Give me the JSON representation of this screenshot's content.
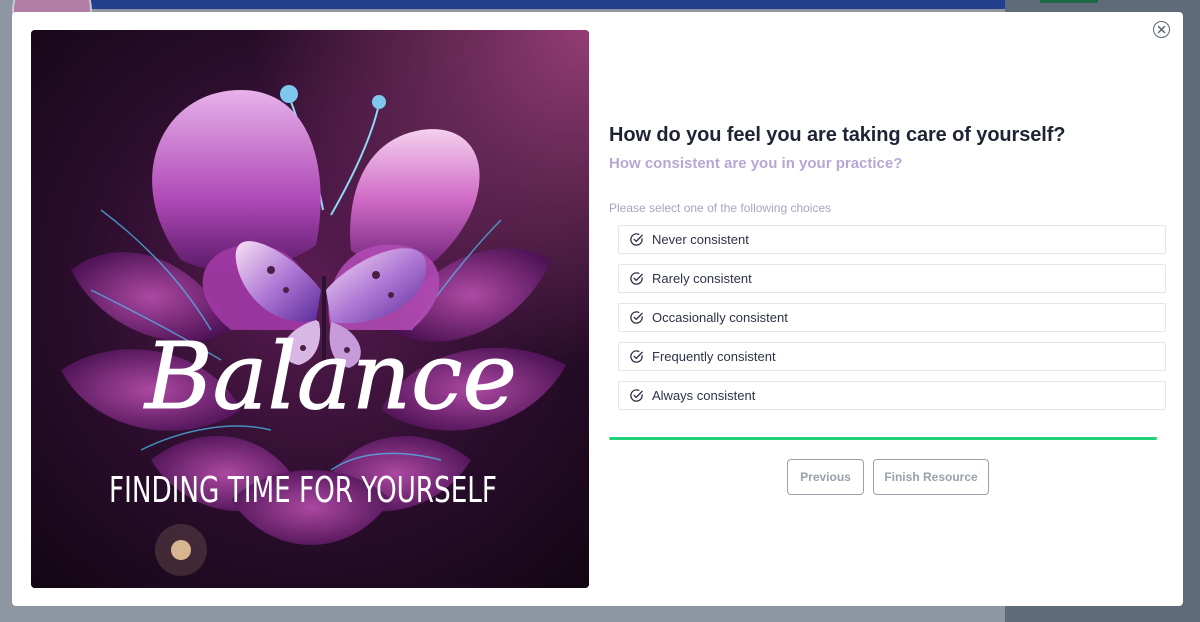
{
  "modal": {
    "close_icon": "close-icon"
  },
  "hero": {
    "title": "Balance",
    "subtitle": "FINDING TIME FOR YOURSELF",
    "alt": "Butterfly on a glowing purple flower"
  },
  "quiz": {
    "question": "How do you feel you are taking care of yourself?",
    "subquestion": "How consistent are you in your practice?",
    "instructions": "Please select one of the following choices",
    "choices": [
      {
        "label": "Never consistent",
        "icon": "check-circle-icon"
      },
      {
        "label": "Rarely consistent",
        "icon": "check-circle-icon"
      },
      {
        "label": "Occasionally consistent",
        "icon": "check-circle-icon"
      },
      {
        "label": "Frequently consistent",
        "icon": "check-circle-icon"
      },
      {
        "label": "Always consistent",
        "icon": "check-circle-icon"
      }
    ],
    "progress": 1.0,
    "buttons": {
      "previous": "Previous",
      "finish": "Finish Resource"
    }
  },
  "colors": {
    "accent_progress": "#22d17a",
    "question_text": "#1e2433",
    "subquestion_text": "#b5a8d4",
    "background_header": "#233e8b"
  }
}
